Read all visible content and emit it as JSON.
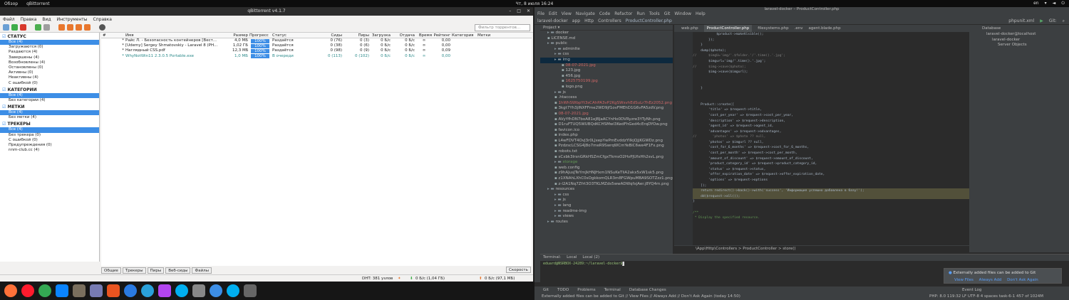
{
  "topbar": {
    "activities": "Обзор",
    "app": "qBittorrent",
    "clock": "Чт, 8 июля 16:24",
    "lang": "en"
  },
  "qb": {
    "title": "qBittorrent v4.1.7",
    "menu": [
      "Файл",
      "Правка",
      "Вид",
      "Инструменты",
      "Справка"
    ],
    "filter_placeholder": "Фильтр торрентов...",
    "sections": {
      "status": {
        "title": "СТАТУС",
        "items": [
          "Все (4)",
          "Загружаются (0)",
          "Раздаются (4)",
          "Завершены (4)",
          "Возобновлены (4)",
          "Остановлены (0)",
          "Активны (0)",
          "Неактивны (4)",
          "С ошибкой (0)"
        ]
      },
      "categories": {
        "title": "КАТЕГОРИИ",
        "items": [
          "Все (4)",
          "Без категории (4)"
        ]
      },
      "tags": {
        "title": "МЕТКИ",
        "items": [
          "Все (4)",
          "Без метки (4)"
        ]
      },
      "trackers": {
        "title": "ТРЕКЕРЫ",
        "items": [
          "Все (4)",
          "Без трекера (0)",
          "С ошибкой (0)",
          "Предупреждения (0)",
          "nnm-club.cc (4)"
        ]
      }
    },
    "columns": [
      "#",
      "Имя",
      "Размер",
      "Прогресс",
      "Статус",
      "Сиды",
      "Пиры",
      "Загрузка",
      "Отдача",
      "Время",
      "Рейтинг",
      "Категория",
      "Метки"
    ],
    "rows": [
      {
        "num": "*",
        "name": "Райс Л. - Безопасность контейнеров [Вест...",
        "size": "4,0 МБ",
        "progress": "100%",
        "status": "Раздаётся",
        "seeds": "0 (76)",
        "peers": "0 (3)",
        "down": "0 Б/с",
        "up": "0 Б/с",
        "eta": "∞",
        "ratio": "0,00",
        "queued": false
      },
      {
        "num": "*",
        "name": "[Udemy] Sergey Shmatovskiy - Laravel 8 (PH...",
        "size": "1,02 ГБ",
        "progress": "100%",
        "status": "Раздаётся",
        "seeds": "0 (38)",
        "peers": "0 (6)",
        "down": "0 Б/с",
        "up": "0 Б/с",
        "eta": "∞",
        "ratio": "0,00",
        "queued": false
      },
      {
        "num": "*",
        "name": "Наглядный CSS.pdf",
        "size": "12,3 МБ",
        "progress": "100%",
        "status": "Раздаётся",
        "seeds": "0 (98)",
        "peers": "0 (9)",
        "down": "0 Б/с",
        "up": "0 Б/с",
        "eta": "∞",
        "ratio": "0,09",
        "queued": false
      },
      {
        "num": "*",
        "name": "WhyNotWin11 2.3.0.5 Portable.exe",
        "size": "1,0 МБ",
        "progress": "100%",
        "status": "В очереди",
        "seeds": "0 (113)",
        "peers": "0 (102)",
        "down": "0 Б/с",
        "up": "0 Б/с",
        "eta": "∞",
        "ratio": "0,00",
        "queued": true
      }
    ],
    "bottom_tabs": [
      "Общие",
      "Трекеры",
      "Пиры",
      "Веб-сиды",
      "Файлы"
    ],
    "speed_button": "Скорость",
    "status": {
      "dht": "DHT: 381 узлов",
      "down": "0 Б/с (1,04 ГБ)",
      "up": "0 Б/с (97,1 МБ)"
    }
  },
  "ps": {
    "title": "laravel-docker – ProductController.php",
    "menu": [
      "File",
      "Edit",
      "View",
      "Navigate",
      "Code",
      "Refactor",
      "Run",
      "Tools",
      "Git",
      "Window",
      "Help"
    ],
    "nav": [
      "laravel-docker",
      "app",
      "Http",
      "Controllers",
      "ProductController.php"
    ],
    "run_config": "phpunit.xml",
    "git": "Git:",
    "project_label": "Project",
    "tabs": [
      "web.php",
      "ProductController.php",
      "filesystems.php",
      ".env",
      "agent.blade.php"
    ],
    "tree": [
      {
        "t": "docker",
        "d": 1,
        "k": "dir"
      },
      {
        "t": "LICENSE.md",
        "d": 1,
        "k": "file"
      },
      {
        "t": "public",
        "d": 1,
        "k": "dir"
      },
      {
        "t": "adminlte",
        "d": 2,
        "k": "dir"
      },
      {
        "t": "css",
        "d": 2,
        "k": "dir"
      },
      {
        "t": "img",
        "d": 2,
        "k": "dir",
        "sel": true
      },
      {
        "t": "08-07-2021.jpg",
        "d": 3,
        "k": "red"
      },
      {
        "t": "123.jpg",
        "d": 3,
        "k": "file"
      },
      {
        "t": "456.jpg",
        "d": 3,
        "k": "file"
      },
      {
        "t": "1625750199.jpg",
        "d": 3,
        "k": "red"
      },
      {
        "t": "logo.png",
        "d": 3,
        "k": "file"
      },
      {
        "t": "js",
        "d": 2,
        "k": "dir"
      },
      {
        "t": ".htaccess",
        "d": 2,
        "k": "file"
      },
      {
        "t": "1hWhSWbpYt3sCAhPA3vP2KgSWsvhEdSuLr7hEz2052.png",
        "d": 2,
        "k": "red"
      },
      {
        "t": "3kgt7Yh3jlNXFFme2WD9jf1ovFMEhD1G6vFA5zdV.png",
        "d": 2,
        "k": "file"
      },
      {
        "t": "08-07-2021.jpg",
        "d": 2,
        "k": "red"
      },
      {
        "t": "AVyYfhDN7boA81eJBJaACYnHo0DVRyzre3YTyNh.png",
        "d": 2,
        "k": "file"
      },
      {
        "t": "D1ruFTUQ5WUBQdKCHSMwI3KedFhGed4cErqDYOw.png",
        "d": 2,
        "k": "file"
      },
      {
        "t": "favicon.ico",
        "d": 2,
        "k": "file"
      },
      {
        "t": "index.php",
        "d": 2,
        "k": "file"
      },
      {
        "t": "L4wFDVT4OvJ3r0LJxepYwPmEvddzYlIkjQjjKGWDz.png",
        "d": 2,
        "k": "file"
      },
      {
        "t": "PzdzscLCSG4J8o7meR9SwrqWCmYeBiC6we4F1Fx.png",
        "d": 2,
        "k": "file"
      },
      {
        "t": "robots.txt",
        "d": 2,
        "k": "file"
      },
      {
        "t": "sCxbk3lrsnGRkHSZmCfgxTkmsO2HvPJUfxHh2svL.png",
        "d": 2,
        "k": "file"
      },
      {
        "t": "storage",
        "d": 2,
        "k": "grn"
      },
      {
        "t": "web.config",
        "d": 2,
        "k": "file"
      },
      {
        "t": "z9hAJusJTeYmJkHNJHxm1NSuKeTliA2akx5xW1sk5.png",
        "d": 2,
        "k": "file"
      },
      {
        "t": "z1XNAhLXhC0sOgkkomQLR3m8FGWpuMBA9SOTZzz1.png",
        "d": 2,
        "k": "file"
      },
      {
        "t": "z-l2A1Nq7Zfrt3O3TKLMZds5wwADWqfxjAer.j8YQ4m.png",
        "d": 2,
        "k": "file"
      },
      {
        "t": "resources",
        "d": 1,
        "k": "dir"
      },
      {
        "t": "css",
        "d": 2,
        "k": "dir"
      },
      {
        "t": "js",
        "d": 2,
        "k": "dir"
      },
      {
        "t": "lang",
        "d": 2,
        "k": "dir"
      },
      {
        "t": "readme-img",
        "d": 2,
        "k": "dir"
      },
      {
        "t": "views",
        "d": 2,
        "k": "dir"
      },
      {
        "t": "routes",
        "d": 1,
        "k": "dir"
      }
    ],
    "code": [
      {
        "n": "",
        "s": "            $product->makeVisible();"
      },
      {
        "n": "",
        "s": "        });"
      },
      {
        "n": "",
        "s": "    }"
      },
      {
        "n": "",
        "s": "    dump($photo);"
      },
      {
        "n": "",
        "s": "//      $imgU='img/'.$folder.'/'.time().'.jpg';"
      },
      {
        "n": "",
        "s": "        $imgurl='img/'.time().'.jpg';"
      },
      {
        "n": "",
        "s": "//      $img->save($photo);"
      },
      {
        "n": "",
        "s": "        $img->save($imgurl);"
      },
      {
        "n": "",
        "s": ""
      },
      {
        "n": "",
        "s": ""
      },
      {
        "n": "",
        "s": "    }"
      },
      {
        "n": "",
        "s": ""
      },
      {
        "n": "",
        "s": ""
      },
      {
        "n": "",
        "s": "    Product::create(["
      },
      {
        "n": "",
        "s": "        'title' => $request->title,"
      },
      {
        "n": "",
        "s": "        'cost_per_year' => $request->cost_per_year,"
      },
      {
        "n": "",
        "s": "        'description' => $request->description,"
      },
      {
        "n": "",
        "s": "        'agent_id' => $request->agent_id,"
      },
      {
        "n": "",
        "s": "        'advantages' => $request->advantages,"
      },
      {
        "n": "",
        "s": "//        'photos' => $photo ?? null,"
      },
      {
        "n": "",
        "s": "        'photos' => $imgurl ?? null,"
      },
      {
        "n": "",
        "s": "        'cost_for_6_months' => $request->cost_for_6_months,"
      },
      {
        "n": "",
        "s": "        'cost_per_month' => $request->cost_per_month,"
      },
      {
        "n": "",
        "s": "        'amount_of_discount' => $request->amount_of_discount,"
      },
      {
        "n": "",
        "s": "        'product_category_id' => $request->product_category_id,"
      },
      {
        "n": "",
        "s": "        'status' => $request->status,"
      },
      {
        "n": "",
        "s": "        'offer_expiration_date' => $request->offer_expiration_date,"
      },
      {
        "n": "",
        "s": "        'options' => $request->options"
      },
      {
        "n": "",
        "s": "    ]);"
      },
      {
        "n": "",
        "s": "    return redirect()->back()->with('success', 'Информация успешно добавлена в базу!');"
      },
      {
        "n": "",
        "s": "    dd($request->all());"
      },
      {
        "n": "",
        "s": "}"
      },
      {
        "n": "",
        "s": ""
      },
      {
        "n": "",
        "s": "/**"
      },
      {
        "n": "",
        "s": " * Display the specified resource."
      }
    ],
    "breadcrumb": "\\App\\Http\\Controllers  >  ProductController  >  store()",
    "database": {
      "title": "Database",
      "items": [
        "laravel-docker@localhost",
        "laravel-docker",
        "Server Objects"
      ]
    },
    "terminal": {
      "label": "Terminal:",
      "tabs": [
        "Local",
        "Local (2)"
      ],
      "prompt": "eduard@NSRBOX-24289:~/laravel-docker$"
    },
    "notification": {
      "text": "Externally added files can be added to Git",
      "links": [
        "View Files",
        "Always Add",
        "Don't Ask Again"
      ]
    },
    "bottom_tools": [
      "Git",
      "TODO",
      "Problems",
      "Terminal",
      "Database Changes"
    ],
    "status_msg": "Externally added files can be added to Git // View Files // Always Add // Don't Ask Again (today 14:50)",
    "status_right": "PHP: 8.0   119:32   LF   UTF-8   4 spaces   task-6-1   457 of 1024M",
    "event_log": "Event Log"
  },
  "dock": [
    "firefox",
    "opera",
    "chrome",
    "thunderbird",
    "files",
    "php",
    "appstore",
    "help",
    "telegram",
    "phpstorm",
    "skype",
    "settings",
    "qbittorrent",
    "skype2",
    "screenshot"
  ],
  "colors": {
    "accent": "#3d8ee6",
    "queued": "#2b8a8a",
    "ps_bg": "#2b2b2b"
  }
}
